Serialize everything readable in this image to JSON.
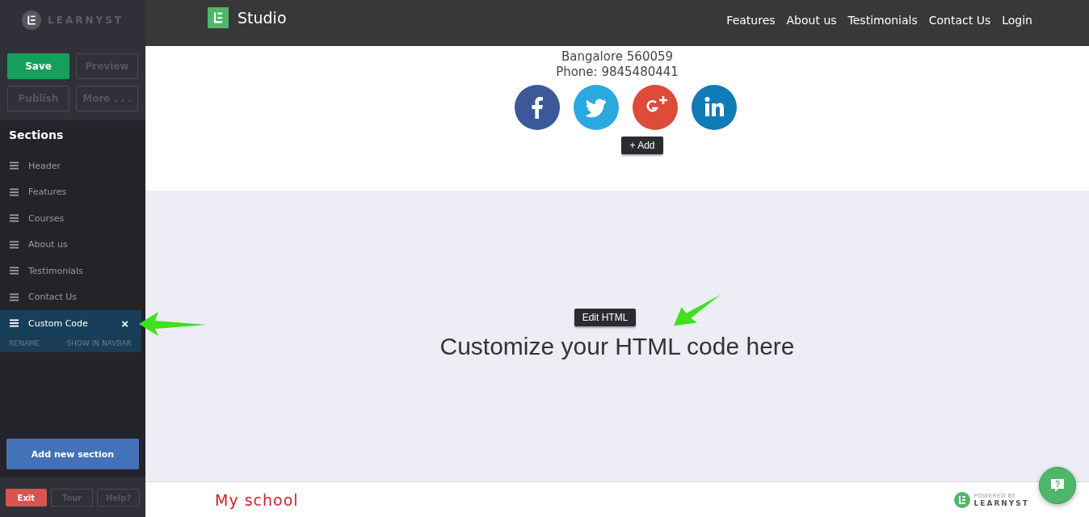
{
  "sidebar": {
    "logo": "LEARNYST",
    "buttons": [
      {
        "label": "Save",
        "kind": "primary"
      },
      {
        "label": "Preview",
        "kind": "outline"
      },
      {
        "label": "Publish",
        "kind": "outline"
      },
      {
        "label": "More . . .",
        "kind": "outline"
      }
    ],
    "sections_title": "Sections",
    "sections": [
      {
        "label": "Header",
        "selected": false
      },
      {
        "label": "Features",
        "selected": false
      },
      {
        "label": "Courses",
        "selected": false
      },
      {
        "label": "About us",
        "selected": false
      },
      {
        "label": "Testimonials",
        "selected": false
      },
      {
        "label": "Contact Us",
        "selected": false
      },
      {
        "label": "Custom Code",
        "selected": true
      }
    ],
    "close": "×",
    "selected_actions": [
      "RENAME",
      "SHOW IN NAVBAR"
    ],
    "add_button": "Add new section",
    "footer_buttons": [
      {
        "label": "Exit",
        "kind": "danger"
      },
      {
        "label": "Tour",
        "kind": "outline"
      },
      {
        "label": "Help?",
        "kind": "outline"
      }
    ]
  },
  "site": {
    "brand": "Studio",
    "nav": [
      "Features",
      "About us",
      "Testimonials",
      "Contact Us",
      "Login"
    ],
    "address": "Bangalore 560059",
    "phone": "Phone: 9845480441",
    "social": [
      {
        "kind": "facebook"
      },
      {
        "kind": "twitter"
      },
      {
        "kind": "googleplus"
      },
      {
        "kind": "linkedin"
      }
    ],
    "add_tooltip": "+ Add",
    "custom_section": {
      "tooltip": "Edit HTML",
      "text": "Customize your HTML code here"
    },
    "footer": {
      "school": "My school",
      "powered_by": "POWERED BY",
      "brand": "LEARNYST"
    }
  }
}
